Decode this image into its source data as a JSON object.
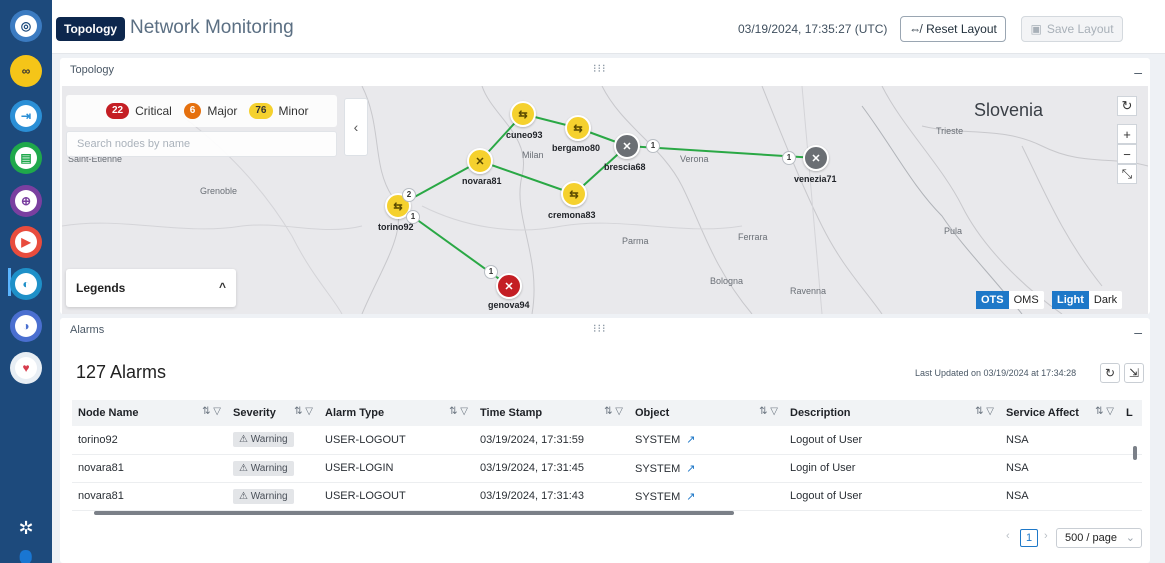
{
  "header": {
    "badge": "Topology",
    "title": "Network Monitoring",
    "timestamp": "03/19/2024, 17:35:27 (UTC)",
    "reset_label": "Reset Layout",
    "save_label": "Save Layout"
  },
  "topology": {
    "panel_title": "Topology",
    "severity": {
      "critical_count": "22",
      "critical_label": "Critical",
      "major_count": "6",
      "major_label": "Major",
      "minor_count": "76",
      "minor_label": "Minor"
    },
    "search_placeholder": "Search nodes by name",
    "legends_label": "Legends",
    "map_labels": {
      "saint_etienne": "Saint-Etienne",
      "grenoble": "Grenoble",
      "milan": "Milan",
      "verona": "Verona",
      "parma": "Parma",
      "ferrara": "Ferrara",
      "bologna": "Bologna",
      "ravenna": "Ravenna",
      "trieste": "Trieste",
      "pula": "Pula",
      "slovenia": "Slovenia"
    },
    "nodes": {
      "cuneo93": "cuneo93",
      "bergamo80": "bergamo80",
      "brescia68": "brescia68",
      "venezia71": "venezia71",
      "novara81": "novara81",
      "cremona83": "cremona83",
      "torino92": "torino92",
      "genova94": "genova94"
    },
    "toggles": {
      "ots": "OTS",
      "oms": "OMS",
      "light": "Light",
      "dark": "Dark"
    },
    "colors": {
      "link": "#2aa845",
      "critical": "#c41e24",
      "major": "#e5700e",
      "minor": "#f5d12e"
    }
  },
  "alarms": {
    "panel_title": "Alarms",
    "count_label": "127 Alarms",
    "last_updated": "Last Updated on 03/19/2024 at 17:34:28",
    "columns": [
      "Node Name",
      "Severity",
      "Alarm Type",
      "Time Stamp",
      "Object",
      "Description",
      "Service Affect",
      "L"
    ],
    "rows": [
      {
        "node": "torino92",
        "severity": "⚠ Warning",
        "type": "USER-LOGOUT",
        "time": "03/19/2024, 17:31:59",
        "object": "SYSTEM",
        "desc": "Logout of User",
        "service": "NSA"
      },
      {
        "node": "novara81",
        "severity": "⚠ Warning",
        "type": "USER-LOGIN",
        "time": "03/19/2024, 17:31:45",
        "object": "SYSTEM",
        "desc": "Login of User",
        "service": "NSA"
      },
      {
        "node": "novara81",
        "severity": "⚠ Warning",
        "type": "USER-LOGOUT",
        "time": "03/19/2024, 17:31:43",
        "object": "SYSTEM",
        "desc": "Logout of User",
        "service": "NSA"
      }
    ],
    "page": "1",
    "page_size": "500 / page"
  }
}
